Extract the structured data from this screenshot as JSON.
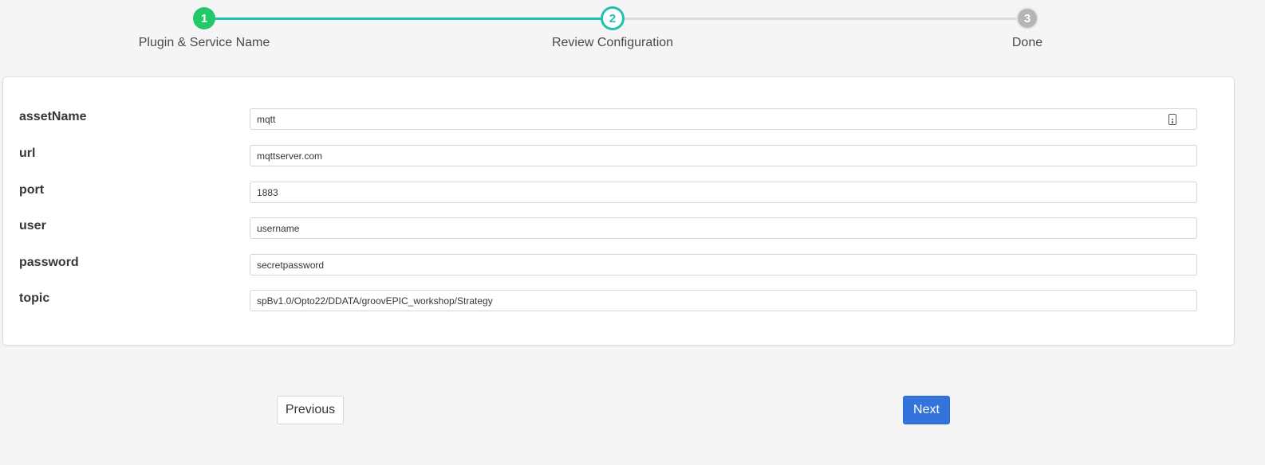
{
  "stepper": {
    "steps": [
      {
        "number": "1",
        "label": "Plugin & Service Name",
        "state": "completed"
      },
      {
        "number": "2",
        "label": "Review Configuration",
        "state": "active"
      },
      {
        "number": "3",
        "label": "Done",
        "state": "pending"
      }
    ],
    "colors": {
      "completed": "#23c969",
      "active": "#1fc1b0",
      "pending": "#b5b5b5"
    }
  },
  "config": {
    "fields": [
      {
        "label": "assetName",
        "value": "mqtt",
        "icon": "contact-card-icon"
      },
      {
        "label": "url",
        "value": "mqttserver.com"
      },
      {
        "label": "port",
        "value": "1883"
      },
      {
        "label": "user",
        "value": "username"
      },
      {
        "label": "password",
        "value": "secretpassword"
      },
      {
        "label": "topic",
        "value": "spBv1.0/Opto22/DDATA/groovEPIC_workshop/Strategy"
      }
    ]
  },
  "navigation": {
    "previous_label": "Previous",
    "next_label": "Next",
    "next_color": "#3273dc"
  }
}
